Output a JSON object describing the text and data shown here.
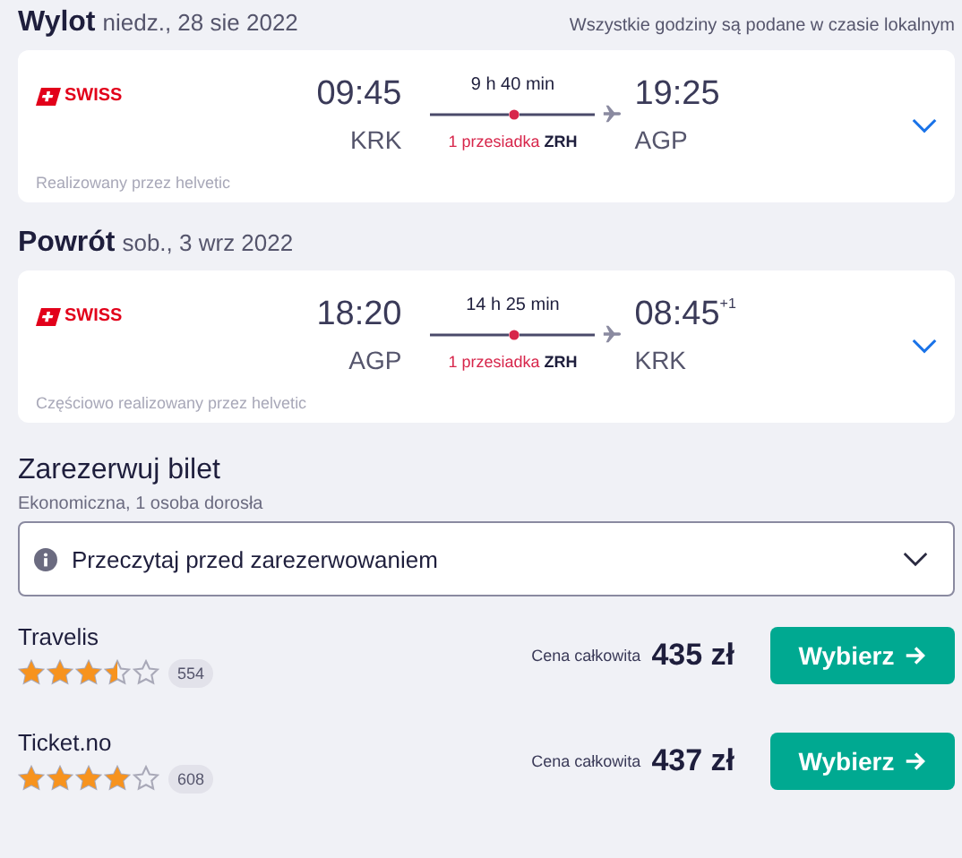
{
  "note": "Wszystkie godziny są podane w czasie lokalnym",
  "legs": [
    {
      "title": "Wylot",
      "date": "niedz., 28 sie 2022",
      "airline": "SWISS",
      "dep_time": "09:45",
      "dep_code": "KRK",
      "duration": "9 h 40 min",
      "stops": "1 przesiadka",
      "via": "ZRH",
      "arr_time": "19:25",
      "arr_code": "AGP",
      "operated": "Realizowany przez helvetic",
      "expanded": false
    },
    {
      "title": "Powrót",
      "date": "sob., 3 wrz 2022",
      "airline": "SWISS",
      "dep_time": "18:20",
      "dep_code": "AGP",
      "duration": "14 h 25 min",
      "stops": "1 przesiadka",
      "via": "ZRH",
      "arr_time": "08:45",
      "arr_plus": "+1",
      "arr_code": "KRK",
      "operated": "Częściowo realizowany przez helvetic",
      "expanded": false
    }
  ],
  "booking": {
    "title": "Zarezerwuj bilet",
    "subtitle": "Ekonomiczna, 1 osoba dorosła",
    "info": "Przeczytaj przed zarezerwowaniem",
    "info_expanded": false
  },
  "offers": [
    {
      "name": "Travelis",
      "stars": 3.5,
      "reviews": "554",
      "price_label": "Cena całkowita",
      "price": "435 zł",
      "button": "Wybierz"
    },
    {
      "name": "Ticket.no",
      "stars": 4,
      "reviews": "608",
      "price_label": "Cena całkowita",
      "price": "437 zł",
      "button": "Wybierz"
    }
  ]
}
